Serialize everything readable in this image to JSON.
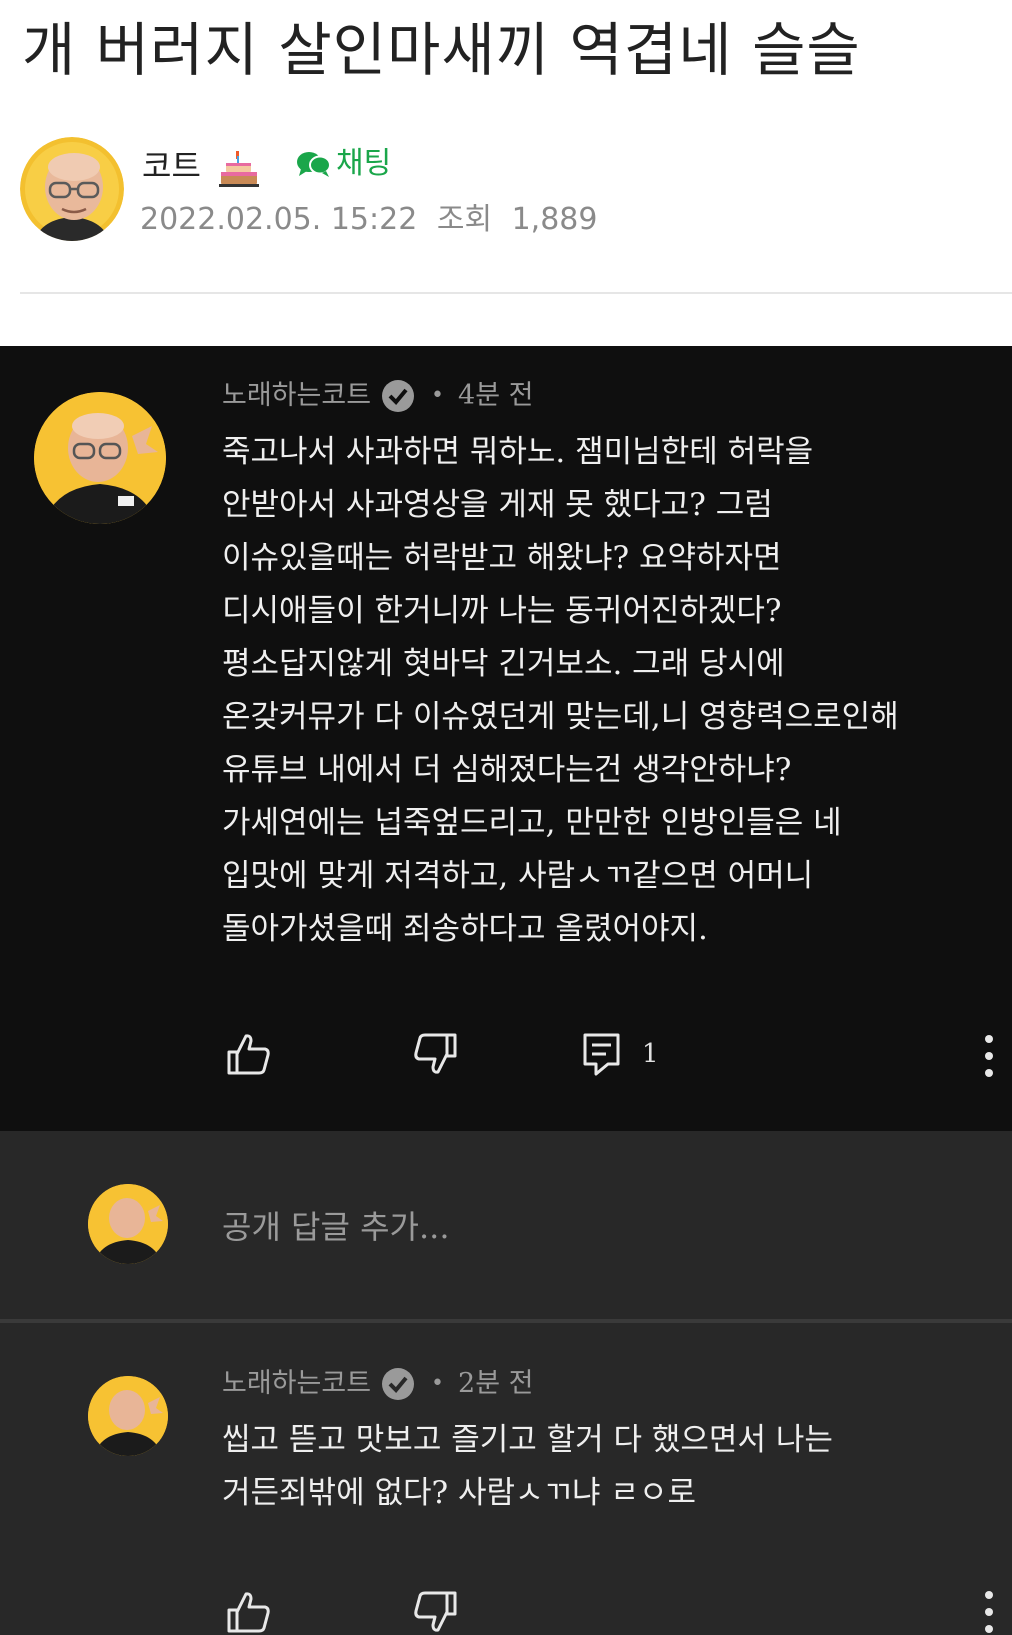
{
  "post": {
    "title": "개 버러지 살인마새끼 역겹네 슬슬",
    "author": "코트",
    "chat_label": "채팅",
    "date": "2022.02.05. 15:22",
    "views_label": "조회",
    "views": "1,889"
  },
  "comments": [
    {
      "author": "노래하는코트",
      "time": "4분 전",
      "lines": [
        "죽고나서 사과하면 뭐하노. 잼미님한테 허락을",
        "안받아서 사과영상을 게재 못 했다고? 그럼",
        "이슈있을때는 허락받고 해왔냐? 요약하자면",
        "디시애들이 한거니까 나는 동귀어진하겠다?",
        "평소답지않게 혓바닥 긴거보소. 그래 당시에",
        "온갖커뮤가 다 이슈였던게 맞는데,니 영향력으로인해",
        "유튜브 내에서 더 심해졌다는건 생각안하냐?",
        "가세연에는 넙죽엎드리고, 만만한 인방인들은 네",
        "입맛에 맞게 저격하고, 사람ㅅㄲ같으면 어머니",
        "돌아가셨을때 죄송하다고 올렸어야지."
      ],
      "reply_count": "1"
    },
    {
      "author": "노래하는코트",
      "time": "2분 전",
      "lines": [
        "씹고 뜯고 맛보고 즐기고 할거 다 했으면서 나는",
        "거든죄밖에 없다? 사람ㅅㄲ냐 ㄹㅇ로"
      ]
    }
  ],
  "add_reply_placeholder": "공개 답글 추가...",
  "icons": {
    "like": "thumbs-up-icon",
    "dislike": "thumbs-down-icon",
    "reply": "reply-icon",
    "more": "more-vertical-icon",
    "verified": "verified-icon",
    "chat": "chat-bubble-icon",
    "cake": "cake-icon"
  },
  "colors": {
    "chat_green": "#1aa64a",
    "avatar_yellow": "#f7c233",
    "dark_bg": "#0f0f0f",
    "panel_bg": "#282828"
  }
}
